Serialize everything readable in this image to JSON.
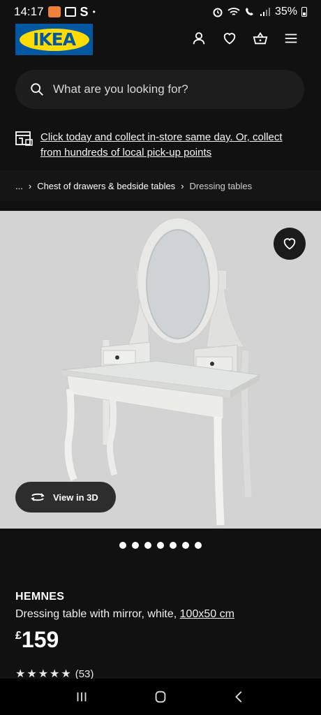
{
  "status_bar": {
    "time": "14:17",
    "battery": "35%",
    "icons": [
      "notification-badge-icon",
      "gallery-icon",
      "s-icon",
      "alarm-icon",
      "wifi-icon",
      "wifi-calling-icon",
      "signal-icon",
      "battery-icon"
    ]
  },
  "header": {
    "logo_text": "IKEA",
    "icons": [
      "profile-icon",
      "heart-icon",
      "basket-icon",
      "menu-icon"
    ]
  },
  "search": {
    "placeholder": "What are you looking for?"
  },
  "promo": {
    "text": "Click today and collect in-store same day. Or, collect from hundreds of local pick-up points"
  },
  "breadcrumb": {
    "ellipsis": "...",
    "items": [
      "Chest of drawers & bedside tables",
      "Dressing tables"
    ]
  },
  "gallery": {
    "view_3d_label": "View in 3D",
    "image_count": 7,
    "active_index": 0
  },
  "product": {
    "name": "HEMNES",
    "description": "Dressing table with mirror, white,",
    "size": "100x50 cm",
    "currency": "£",
    "price": "159",
    "rating_count": "(53)"
  },
  "colors": {
    "background": "#111111",
    "ikea_blue": "#0058a3",
    "ikea_yellow": "#ffdb00",
    "image_bg": "#d3d3d3"
  }
}
